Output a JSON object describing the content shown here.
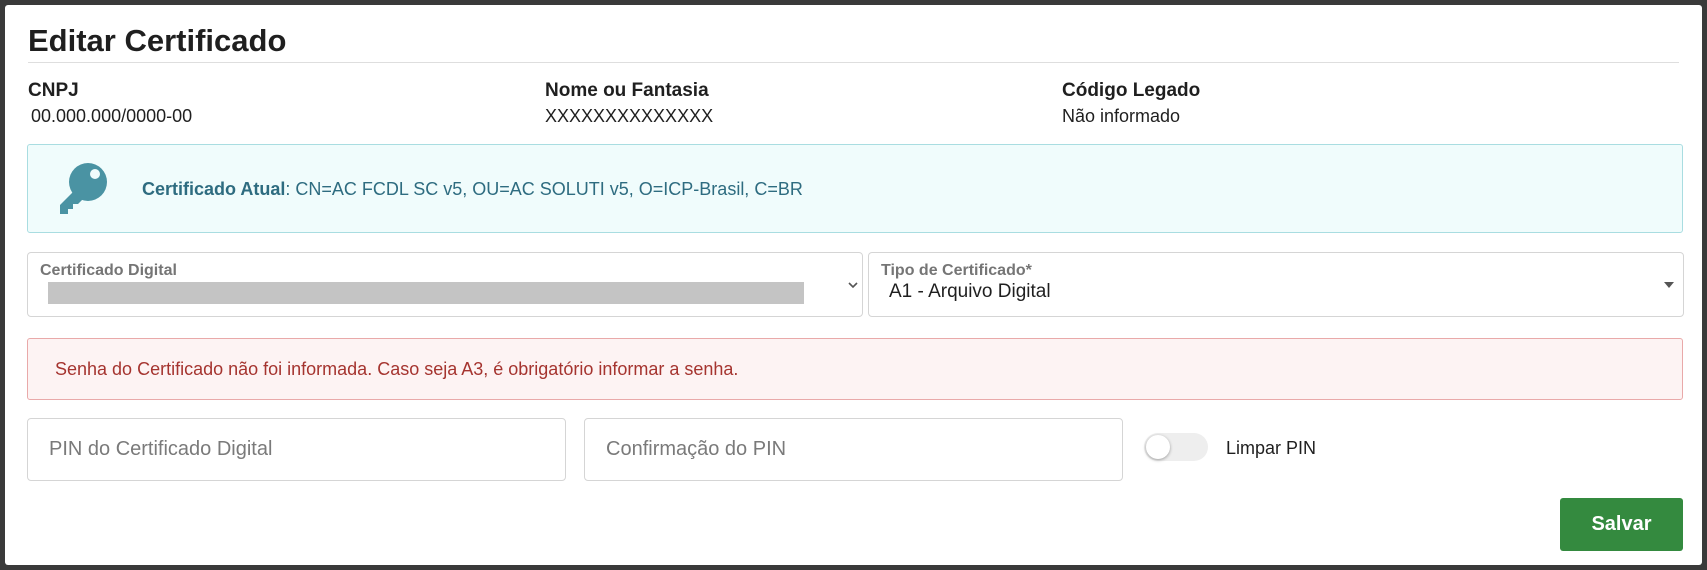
{
  "modal": {
    "title": "Editar Certificado"
  },
  "company": {
    "cnpj_label": "CNPJ",
    "cnpj_value": "00.000.000/0000-00",
    "name_label": "Nome ou Fantasia",
    "name_value": "XXXXXXXXXXXXXX",
    "legacy_label": "Código Legado",
    "legacy_value": "Não informado"
  },
  "current_certificate": {
    "icon": "key-icon",
    "label": "Certificado Atual",
    "separator": ": ",
    "value": "CN=AC FCDL SC v5, OU=AC SOLUTI v5, O=ICP-Brasil, C=BR",
    "bg_color": "#f0fcfc",
    "text_color": "#2e6c80"
  },
  "certificate_select": {
    "label": "Certificado Digital",
    "icon": "chevron-down-icon"
  },
  "type_select": {
    "label": "Tipo de Certificado*",
    "value": "A1 - Arquivo Digital",
    "icon": "caret-down-icon"
  },
  "error": {
    "message": "Senha do Certificado não foi informada. Caso seja A3, é obrigatório informar a senha.",
    "color": "#a5342f"
  },
  "pin": {
    "placeholder": "PIN do Certificado Digital",
    "value": ""
  },
  "pin_confirm": {
    "placeholder": "Confirmação do PIN",
    "value": ""
  },
  "clear_pin": {
    "label": "Limpar PIN",
    "checked": false
  },
  "actions": {
    "save_label": "Salvar",
    "save_color": "#348a3f"
  }
}
